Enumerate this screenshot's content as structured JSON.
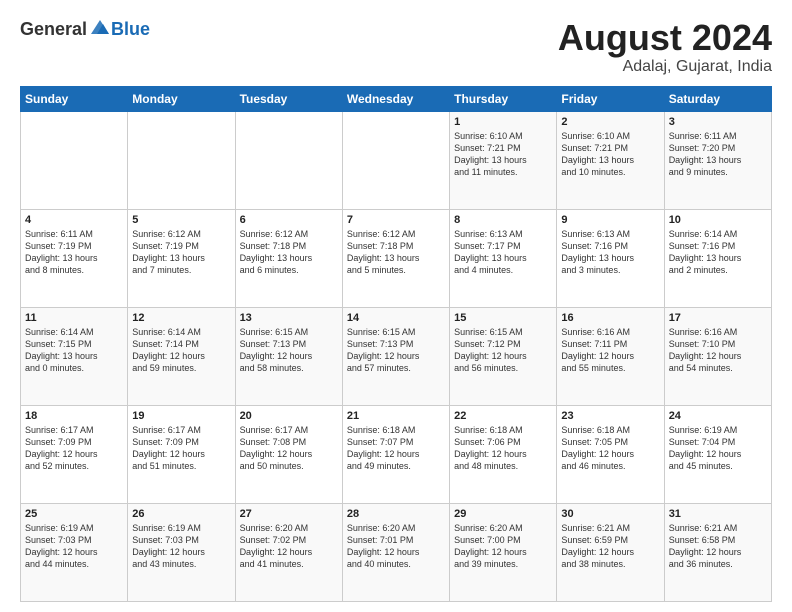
{
  "logo": {
    "general": "General",
    "blue": "Blue"
  },
  "title": "August 2024",
  "subtitle": "Adalaj, Gujarat, India",
  "days_header": [
    "Sunday",
    "Monday",
    "Tuesday",
    "Wednesday",
    "Thursday",
    "Friday",
    "Saturday"
  ],
  "weeks": [
    [
      {
        "day": "",
        "info": ""
      },
      {
        "day": "",
        "info": ""
      },
      {
        "day": "",
        "info": ""
      },
      {
        "day": "",
        "info": ""
      },
      {
        "day": "1",
        "info": "Sunrise: 6:10 AM\nSunset: 7:21 PM\nDaylight: 13 hours\nand 11 minutes."
      },
      {
        "day": "2",
        "info": "Sunrise: 6:10 AM\nSunset: 7:21 PM\nDaylight: 13 hours\nand 10 minutes."
      },
      {
        "day": "3",
        "info": "Sunrise: 6:11 AM\nSunset: 7:20 PM\nDaylight: 13 hours\nand 9 minutes."
      }
    ],
    [
      {
        "day": "4",
        "info": "Sunrise: 6:11 AM\nSunset: 7:19 PM\nDaylight: 13 hours\nand 8 minutes."
      },
      {
        "day": "5",
        "info": "Sunrise: 6:12 AM\nSunset: 7:19 PM\nDaylight: 13 hours\nand 7 minutes."
      },
      {
        "day": "6",
        "info": "Sunrise: 6:12 AM\nSunset: 7:18 PM\nDaylight: 13 hours\nand 6 minutes."
      },
      {
        "day": "7",
        "info": "Sunrise: 6:12 AM\nSunset: 7:18 PM\nDaylight: 13 hours\nand 5 minutes."
      },
      {
        "day": "8",
        "info": "Sunrise: 6:13 AM\nSunset: 7:17 PM\nDaylight: 13 hours\nand 4 minutes."
      },
      {
        "day": "9",
        "info": "Sunrise: 6:13 AM\nSunset: 7:16 PM\nDaylight: 13 hours\nand 3 minutes."
      },
      {
        "day": "10",
        "info": "Sunrise: 6:14 AM\nSunset: 7:16 PM\nDaylight: 13 hours\nand 2 minutes."
      }
    ],
    [
      {
        "day": "11",
        "info": "Sunrise: 6:14 AM\nSunset: 7:15 PM\nDaylight: 13 hours\nand 0 minutes."
      },
      {
        "day": "12",
        "info": "Sunrise: 6:14 AM\nSunset: 7:14 PM\nDaylight: 12 hours\nand 59 minutes."
      },
      {
        "day": "13",
        "info": "Sunrise: 6:15 AM\nSunset: 7:13 PM\nDaylight: 12 hours\nand 58 minutes."
      },
      {
        "day": "14",
        "info": "Sunrise: 6:15 AM\nSunset: 7:13 PM\nDaylight: 12 hours\nand 57 minutes."
      },
      {
        "day": "15",
        "info": "Sunrise: 6:15 AM\nSunset: 7:12 PM\nDaylight: 12 hours\nand 56 minutes."
      },
      {
        "day": "16",
        "info": "Sunrise: 6:16 AM\nSunset: 7:11 PM\nDaylight: 12 hours\nand 55 minutes."
      },
      {
        "day": "17",
        "info": "Sunrise: 6:16 AM\nSunset: 7:10 PM\nDaylight: 12 hours\nand 54 minutes."
      }
    ],
    [
      {
        "day": "18",
        "info": "Sunrise: 6:17 AM\nSunset: 7:09 PM\nDaylight: 12 hours\nand 52 minutes."
      },
      {
        "day": "19",
        "info": "Sunrise: 6:17 AM\nSunset: 7:09 PM\nDaylight: 12 hours\nand 51 minutes."
      },
      {
        "day": "20",
        "info": "Sunrise: 6:17 AM\nSunset: 7:08 PM\nDaylight: 12 hours\nand 50 minutes."
      },
      {
        "day": "21",
        "info": "Sunrise: 6:18 AM\nSunset: 7:07 PM\nDaylight: 12 hours\nand 49 minutes."
      },
      {
        "day": "22",
        "info": "Sunrise: 6:18 AM\nSunset: 7:06 PM\nDaylight: 12 hours\nand 48 minutes."
      },
      {
        "day": "23",
        "info": "Sunrise: 6:18 AM\nSunset: 7:05 PM\nDaylight: 12 hours\nand 46 minutes."
      },
      {
        "day": "24",
        "info": "Sunrise: 6:19 AM\nSunset: 7:04 PM\nDaylight: 12 hours\nand 45 minutes."
      }
    ],
    [
      {
        "day": "25",
        "info": "Sunrise: 6:19 AM\nSunset: 7:03 PM\nDaylight: 12 hours\nand 44 minutes."
      },
      {
        "day": "26",
        "info": "Sunrise: 6:19 AM\nSunset: 7:03 PM\nDaylight: 12 hours\nand 43 minutes."
      },
      {
        "day": "27",
        "info": "Sunrise: 6:20 AM\nSunset: 7:02 PM\nDaylight: 12 hours\nand 41 minutes."
      },
      {
        "day": "28",
        "info": "Sunrise: 6:20 AM\nSunset: 7:01 PM\nDaylight: 12 hours\nand 40 minutes."
      },
      {
        "day": "29",
        "info": "Sunrise: 6:20 AM\nSunset: 7:00 PM\nDaylight: 12 hours\nand 39 minutes."
      },
      {
        "day": "30",
        "info": "Sunrise: 6:21 AM\nSunset: 6:59 PM\nDaylight: 12 hours\nand 38 minutes."
      },
      {
        "day": "31",
        "info": "Sunrise: 6:21 AM\nSunset: 6:58 PM\nDaylight: 12 hours\nand 36 minutes."
      }
    ]
  ]
}
